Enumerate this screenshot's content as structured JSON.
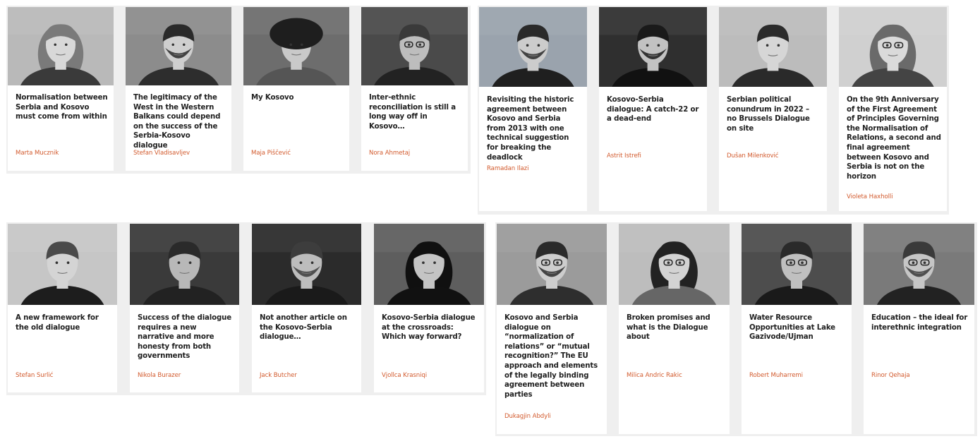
{
  "accent_color": "#d25a2d",
  "articles": [
    {
      "title": "Normalisation between Serbia and Kosovo must come from within",
      "author": "Marta Mucznik",
      "icon": "portrait-photo"
    },
    {
      "title": "The legitimacy of the West in the Western Balkans could depend on the success of the Serbia-Kosovo dialogue",
      "author": "Stefan Vladisavljev",
      "icon": "portrait-photo"
    },
    {
      "title": "My Kosovo",
      "author": "Maja Piščević",
      "icon": "portrait-photo"
    },
    {
      "title": "Inter-ethnic reconciliation is still a long way off in Kosovo…",
      "author": "Nora Ahmetaj",
      "icon": "portrait-photo"
    },
    {
      "title": "Revisiting the historic agreement between Kosovo and Serbia from 2013 with one technical suggestion for breaking the deadlock",
      "author": "Ramadan Ilazi",
      "icon": "portrait-photo"
    },
    {
      "title": "Kosovo-Serbia dialogue: A catch-22 or a dead-end",
      "author": "Astrit Istrefi",
      "icon": "portrait-photo"
    },
    {
      "title": "Serbian political conundrum in 2022 – no Brussels Dialogue on site",
      "author": "Dušan Milenković",
      "icon": "portrait-photo"
    },
    {
      "title": "On the 9th Anniversary of the First Agreement of Principles Governing the Normalisation of Relations, a second and final agreement between Kosovo and Serbia is not on the horizon",
      "author": "Violeta Haxholli",
      "icon": "portrait-photo"
    },
    {
      "title": "A new framework for the old dialogue",
      "author": "Stefan Surlić",
      "icon": "portrait-photo"
    },
    {
      "title": "Success of the dialogue requires a new narrative and more honesty from both governments",
      "author": "Nikola Burazer",
      "icon": "portrait-photo"
    },
    {
      "title": "Not another article on the Kosovo-Serbia dialogue…",
      "author": "Jack Butcher",
      "icon": "portrait-photo"
    },
    {
      "title": "Kosovo-Serbia dialogue at the crossroads: Which way forward?",
      "author": "Vjollca Krasniqi",
      "icon": "portrait-photo"
    },
    {
      "title": "Kosovo and Serbia dialogue on “normalization of relations” or “mutual recognition?” The EU approach and elements of the legally binding agreement between parties",
      "author": "Dukagjin Abdyli",
      "icon": "portrait-photo"
    },
    {
      "title": "Broken promises and what is the Dialogue about",
      "author": "Milica Andric Rakic",
      "icon": "portrait-photo"
    },
    {
      "title": "Water Resource Opportunities at Lake Gazivode/Ujman",
      "author": "Robert Muharremi",
      "icon": "portrait-photo"
    },
    {
      "title": "Education – the ideal for interethnic integration",
      "author": "Rinor Qehaja",
      "icon": "portrait-photo"
    }
  ]
}
